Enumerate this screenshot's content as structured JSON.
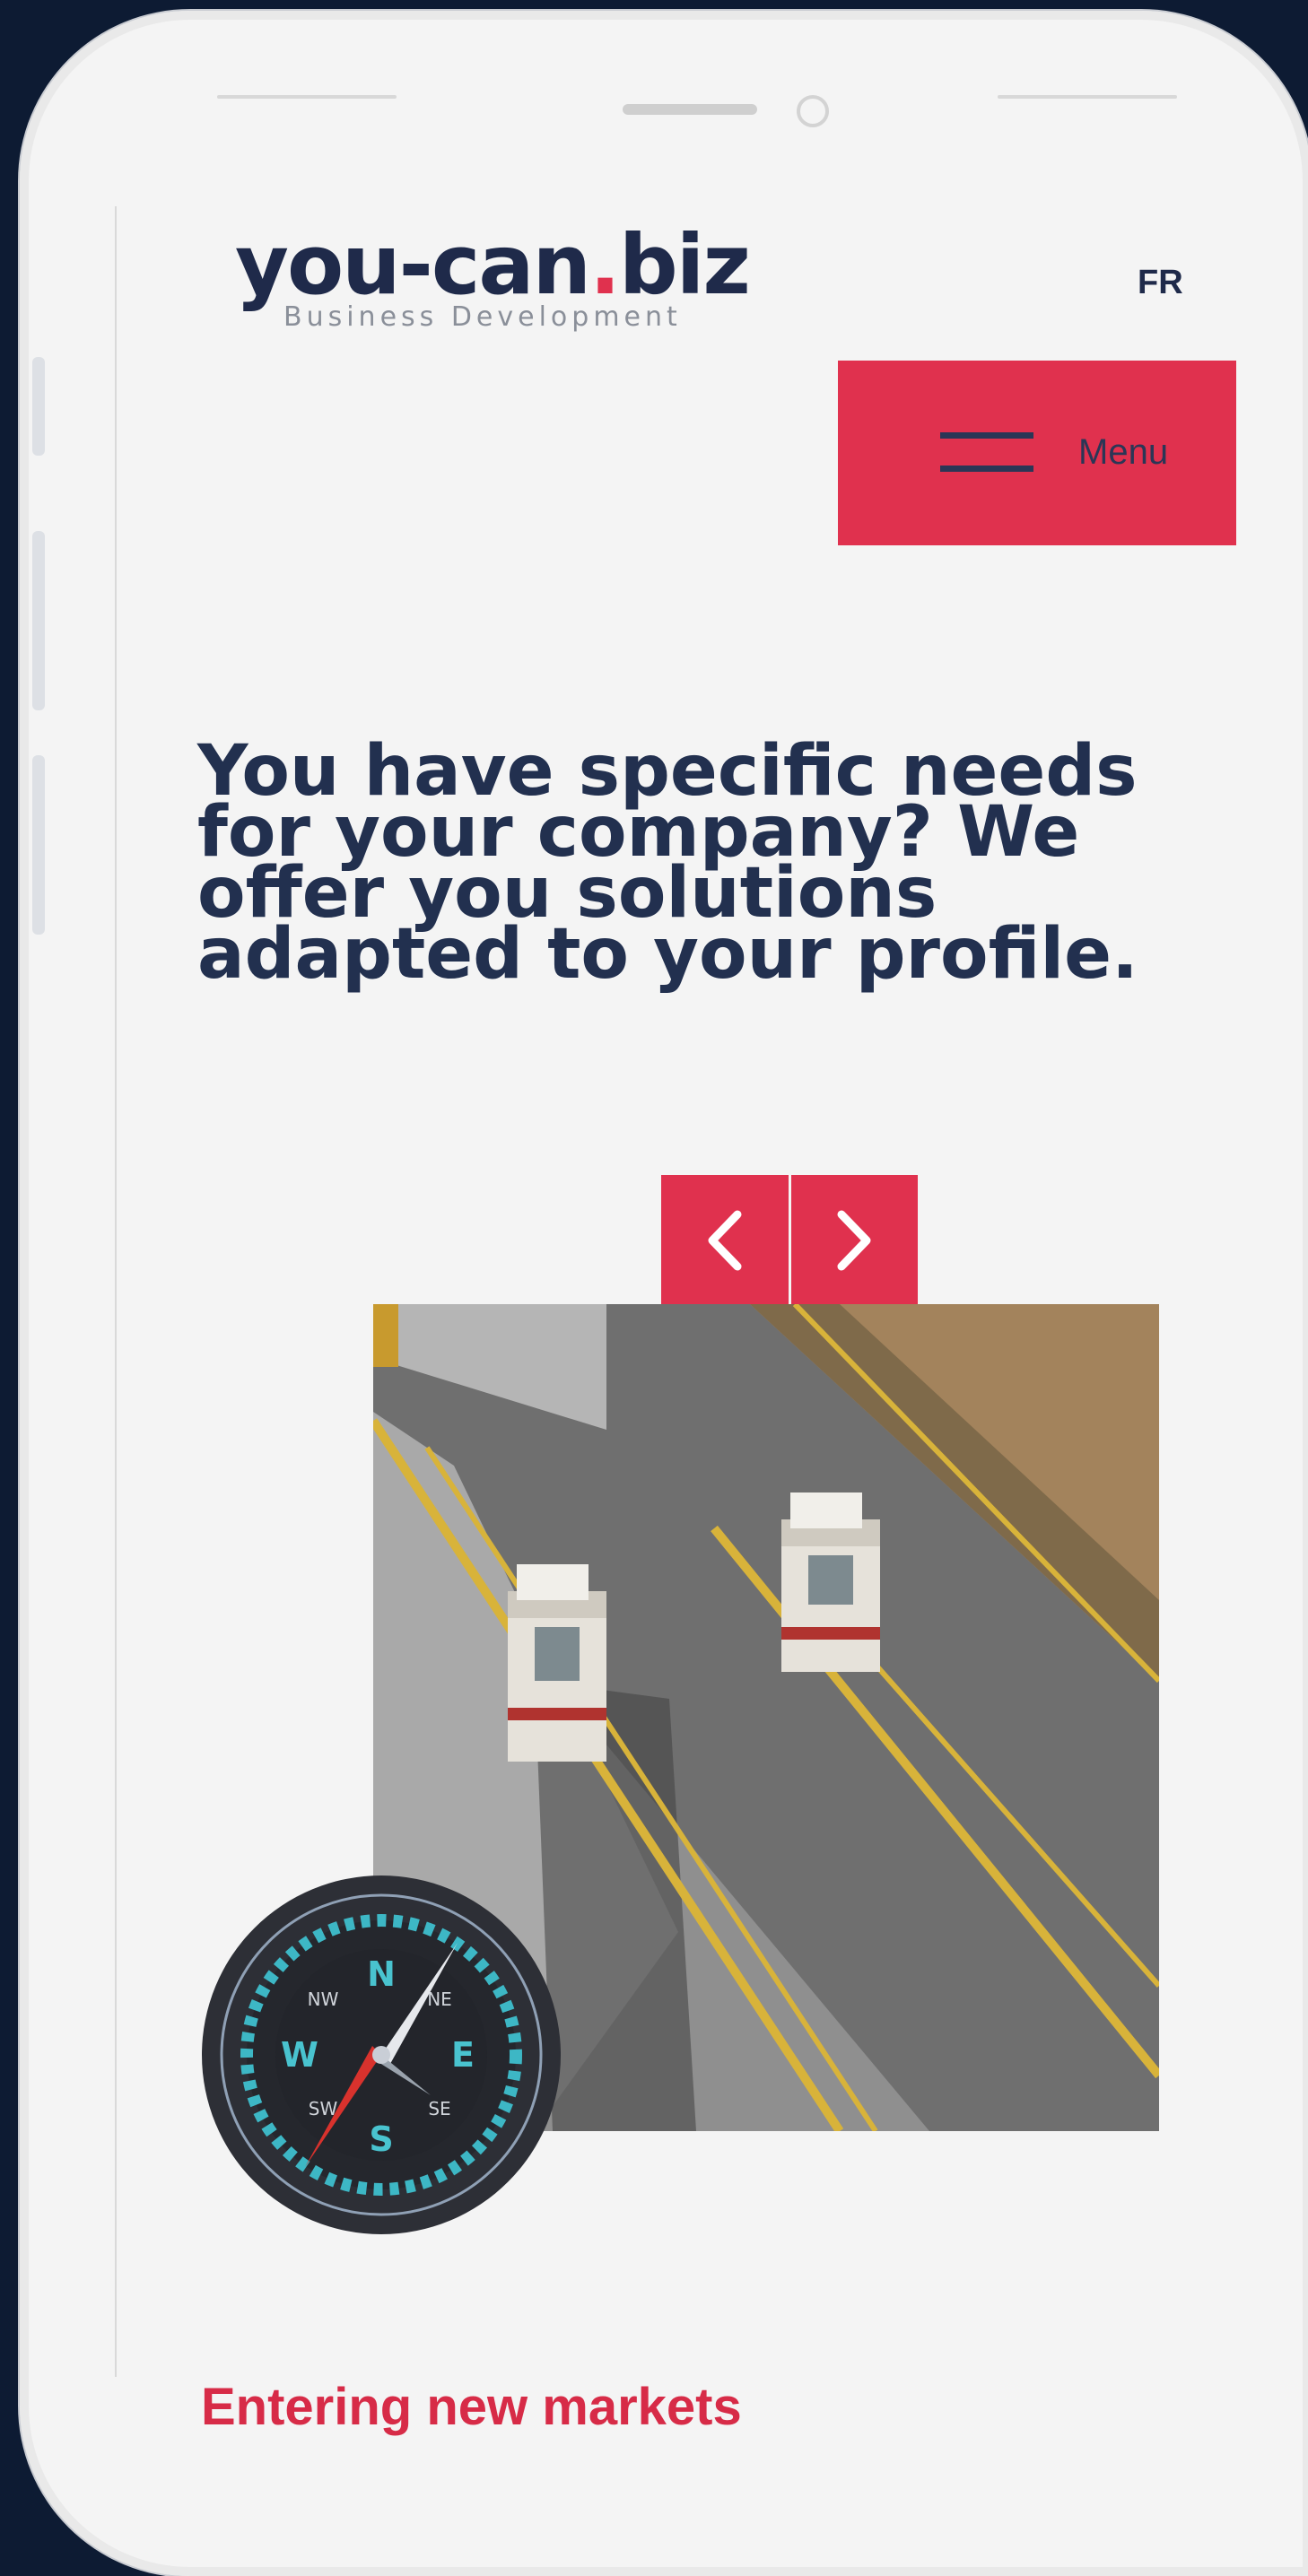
{
  "logo": {
    "main_prefix": "you-can",
    "main_dot": ".",
    "main_suffix": "biz",
    "tagline": "Business Development"
  },
  "header": {
    "language_toggle": "FR",
    "menu_label": "Menu"
  },
  "hero": {
    "headline": "You have specific needs for your company? We offer you solutions adapted to your profile."
  },
  "slider": {
    "prev_icon": "chevron-left-icon",
    "next_icon": "chevron-right-icon"
  },
  "section": {
    "title": "Entering new markets"
  },
  "compass_labels": {
    "n": "N",
    "ne": "NE",
    "e": "E",
    "se": "SE",
    "s": "S",
    "sw": "SW",
    "w": "W",
    "nw": "NW"
  },
  "colors": {
    "accent": "#e0314e",
    "navy": "#22304f",
    "background": "#0d1b33"
  }
}
